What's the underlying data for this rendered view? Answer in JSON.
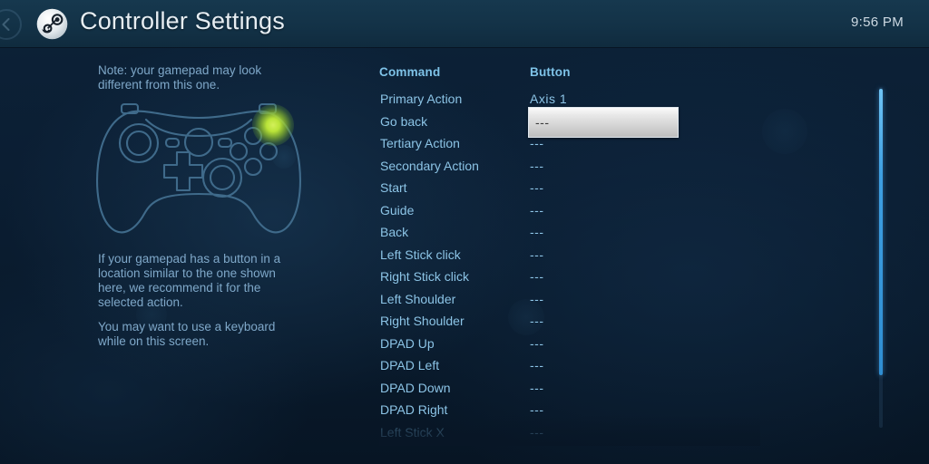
{
  "header": {
    "title": "Controller Settings",
    "clock": "9:56 PM",
    "back_icon": "back-arrow-icon",
    "logo_icon": "steam-logo-icon"
  },
  "left_panel": {
    "note_top": "Note: your gamepad may look different from this one.",
    "note_mid": "If your gamepad has a button in a location similar to the one shown here, we recommend it for the selected action.",
    "note_bottom": "You may want to use a keyboard while on this screen.",
    "controller_icon": "gamepad-outline-icon",
    "highlight_icon": "highlighted-button-glow-icon"
  },
  "bindings": {
    "headers": {
      "command": "Command",
      "button": "Button"
    },
    "selected_index": 1,
    "rows": [
      {
        "command": "Primary Action",
        "button": "Axis 1",
        "dim": false
      },
      {
        "command": "Go back",
        "button": "---",
        "dim": false
      },
      {
        "command": "Tertiary Action",
        "button": "---",
        "dim": false
      },
      {
        "command": "Secondary Action",
        "button": "---",
        "dim": false
      },
      {
        "command": "Start",
        "button": "---",
        "dim": false
      },
      {
        "command": "Guide",
        "button": "---",
        "dim": false
      },
      {
        "command": "Back",
        "button": "---",
        "dim": false
      },
      {
        "command": "Left Stick click",
        "button": "---",
        "dim": false
      },
      {
        "command": "Right Stick click",
        "button": "---",
        "dim": false
      },
      {
        "command": "Left Shoulder",
        "button": "---",
        "dim": false
      },
      {
        "command": "Right Shoulder",
        "button": "---",
        "dim": false
      },
      {
        "command": "DPAD Up",
        "button": "---",
        "dim": false
      },
      {
        "command": "DPAD Left",
        "button": "---",
        "dim": false
      },
      {
        "command": "DPAD Down",
        "button": "---",
        "dim": false
      },
      {
        "command": "DPAD Right",
        "button": "---",
        "dim": false
      },
      {
        "command": "Left Stick X",
        "button": "---",
        "dim": true
      }
    ]
  },
  "scrollbar": {
    "name": "vertical-scrollbar"
  },
  "colors": {
    "accent_blue": "#3e9fe2",
    "header_text": "#7fc3e8",
    "body_text": "#8cc4e6",
    "note_text": "#7fa8c9",
    "highlight_green": "#b9e338",
    "header_bar": "#133247",
    "background": "#0b1e33"
  }
}
